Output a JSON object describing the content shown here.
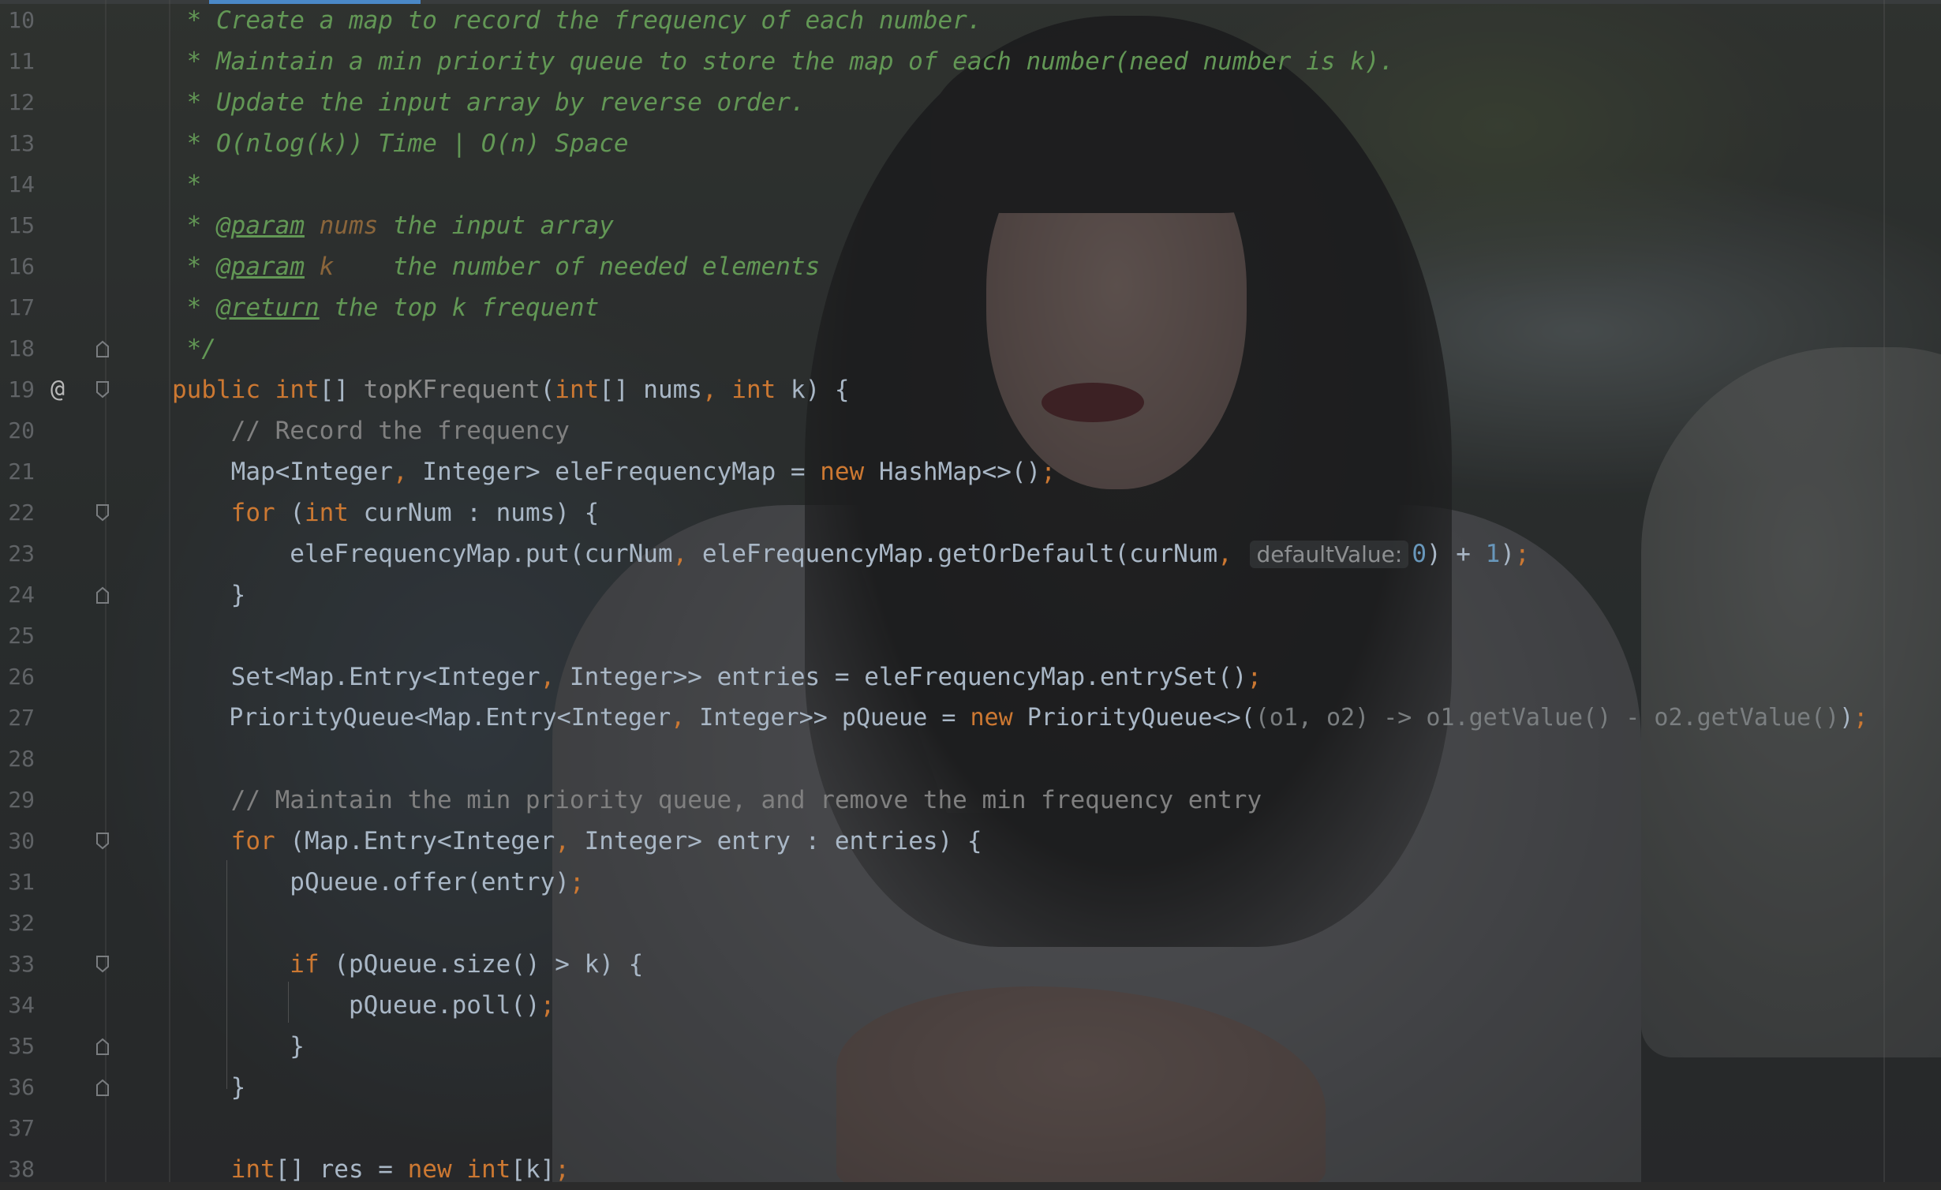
{
  "editor": {
    "gutter_marker": "@",
    "lines": [
      {
        "n": "10",
        "t": " * Create a map to record the frequency of each number."
      },
      {
        "n": "11",
        "t": " * Maintain a min priority queue to store the map of each number(need number is k)."
      },
      {
        "n": "12",
        "t": " * Update the input array by reverse order."
      },
      {
        "n": "13",
        "t": " * O(nlog(k)) Time | O(n) Space"
      },
      {
        "n": "14",
        "t": " *"
      },
      {
        "n": "15",
        "a": " * ",
        "b": "@param",
        "c": " nums",
        "d": " the input array"
      },
      {
        "n": "16",
        "a": " * ",
        "b": "@param",
        "c": " k",
        "d": "    the number of needed elements"
      },
      {
        "n": "17",
        "a": " * ",
        "b": "@return",
        "d": " the top k frequent"
      },
      {
        "n": "18",
        "t": " */"
      },
      {
        "n": "19",
        "k1": "public ",
        "k2": "int",
        "p1": "[] ",
        "fn": "topKFrequent",
        "p2": "(",
        "k3": "int",
        "p3": "[] nums",
        "cma": ",",
        "k4": " int",
        "p4": " k) {"
      },
      {
        "n": "20",
        "t": "    // Record the frequency"
      },
      {
        "n": "21",
        "p1": "    Map<Integer",
        "cma": ",",
        "p2": " Integer> eleFrequencyMap = ",
        "kw": "new",
        "p3": " HashMap<>()",
        "semi": ";"
      },
      {
        "n": "22",
        "kw": "    for",
        "p1": " (",
        "k2": "int",
        "p2": " curNum : nums) {"
      },
      {
        "n": "23",
        "p1": "        eleFrequencyMap.put(curNum",
        "cma": ",",
        "p2": " eleFrequencyMap.getOrDefault(curNum",
        "cma2": ",",
        "hint": "defaultValue:",
        "num1": "0",
        "p3": ") + ",
        "num2": "1",
        "p4": ")",
        "semi": ";"
      },
      {
        "n": "24",
        "t": "    }"
      },
      {
        "n": "25",
        "t": ""
      },
      {
        "n": "26",
        "p1": "    Set<Map.Entry<Integer",
        "cma": ",",
        "p2": " Integer>> entries = eleFrequencyMap.entrySet()",
        "semi": ";"
      },
      {
        "n": "27",
        "p1": "    PriorityQueue<Map.Entry<Integer",
        "cma": ",",
        "p2": " Integer>> pQueue = ",
        "kw": "new",
        "p3": " PriorityQueue<>(",
        "lam": "(o1, o2) -> o1.getValue() - o2.getValue()",
        "p4": ")",
        "semi": ";"
      },
      {
        "n": "28",
        "t": ""
      },
      {
        "n": "29",
        "t": "    // Maintain the min priority queue, and remove the min frequency entry"
      },
      {
        "n": "30",
        "kw": "    for",
        "p1": " (Map.Entry<Integer",
        "cma": ",",
        "p2": " Integer> entry : entries) {"
      },
      {
        "n": "31",
        "p1": "        pQueue.offer(entry)",
        "semi": ";"
      },
      {
        "n": "32",
        "t": ""
      },
      {
        "n": "33",
        "kw": "        if",
        "p1": " (pQueue.size() > k) {"
      },
      {
        "n": "34",
        "p1": "            pQueue.poll()",
        "semi": ";"
      },
      {
        "n": "35",
        "t": "        }"
      },
      {
        "n": "36",
        "t": "    }"
      },
      {
        "n": "37",
        "t": ""
      },
      {
        "n": "38",
        "k1": "    int",
        "p1": "[] res = ",
        "kw": "new",
        "k2": " int",
        "p2": "[k]",
        "semi": ";"
      }
    ]
  },
  "colors": {
    "comment_doc": "#629755",
    "keyword": "#cc7832",
    "text": "#a9b7c6",
    "number": "#6897bb",
    "line_comment": "#808080",
    "accent_tab": "#4a88c7"
  }
}
